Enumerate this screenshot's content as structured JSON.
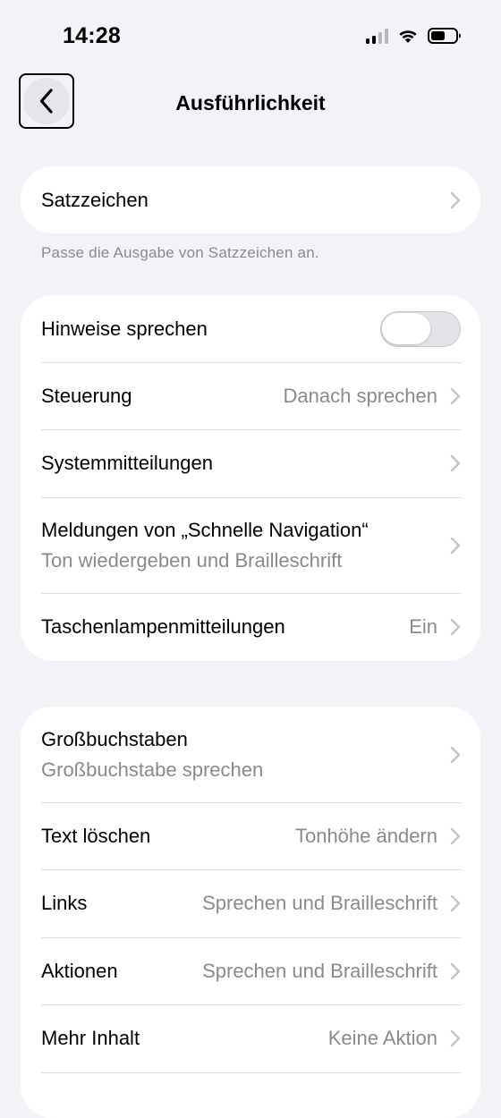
{
  "status_bar": {
    "time": "14:28",
    "icons": [
      "cellular-signal-icon",
      "wifi-icon",
      "battery-icon"
    ]
  },
  "nav": {
    "back_icon": "chevron-left-icon",
    "title": "Ausführlichkeit"
  },
  "group1": {
    "rows": [
      {
        "label": "Satzzeichen"
      }
    ],
    "footnote": "Passe die Ausgabe von Satzzeichen an."
  },
  "group2": {
    "rows": [
      {
        "label": "Hinweise sprechen",
        "toggle_on": false
      },
      {
        "label": "Steuerung",
        "value": "Danach sprechen"
      },
      {
        "label": "Systemmitteilungen"
      },
      {
        "label": "Meldungen von „Schnelle Navigation“",
        "sub": "Ton wiedergeben und Brailleschrift"
      },
      {
        "label": "Taschenlampenmitteilungen",
        "value": "Ein"
      }
    ]
  },
  "group3": {
    "rows": [
      {
        "label": "Großbuchstaben",
        "sub": "Großbuchstabe sprechen"
      },
      {
        "label": "Text löschen",
        "value": "Tonhöhe ändern"
      },
      {
        "label": "Links",
        "value": "Sprechen und Brailleschrift"
      },
      {
        "label": "Aktionen",
        "value": "Sprechen und Brailleschrift"
      },
      {
        "label": "Mehr Inhalt",
        "value": "Keine Aktion"
      }
    ]
  },
  "colors": {
    "background": "#F2F2F7",
    "cell": "#FFFFFF",
    "secondary_text": "#8A8A8E",
    "chevron": "#C4C4C7",
    "separator": "#DCDCE0"
  }
}
